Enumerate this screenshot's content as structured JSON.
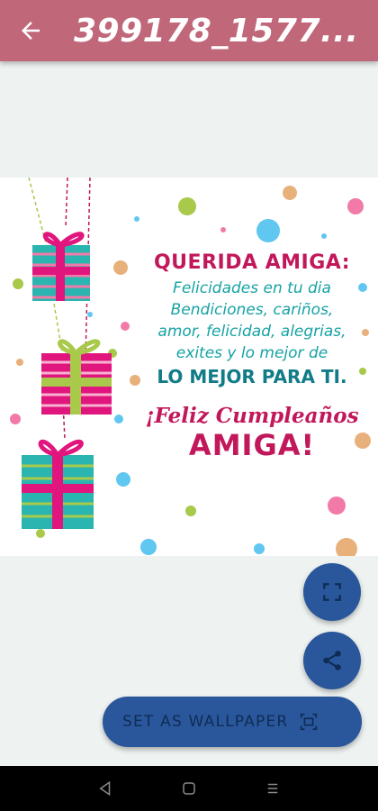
{
  "app_bar": {
    "title": "399178_1577...",
    "back_icon": "arrow-left-icon",
    "color": "#c0677a"
  },
  "card": {
    "heading": "QUERIDA AMIGA:",
    "lines": [
      "Felicidades en tu dia",
      "Bendiciones, cariños,",
      "amor, felicidad, alegrias,",
      "exites y lo mejor de"
    ],
    "closing": "LO MEJOR PARA TI.",
    "script_line": "¡Feliz Cumpleaños",
    "big_line": "AMIGA!"
  },
  "actions": {
    "expand_icon": "fullscreen-icon",
    "share_icon": "share-icon",
    "wallpaper_label": "SET AS WALLPAPER",
    "wallpaper_icon": "wallpaper-icon",
    "color": "#2a579b"
  },
  "system_nav": {
    "back": "nav-back-icon",
    "home": "nav-home-icon",
    "recents": "nav-menu-icon"
  }
}
